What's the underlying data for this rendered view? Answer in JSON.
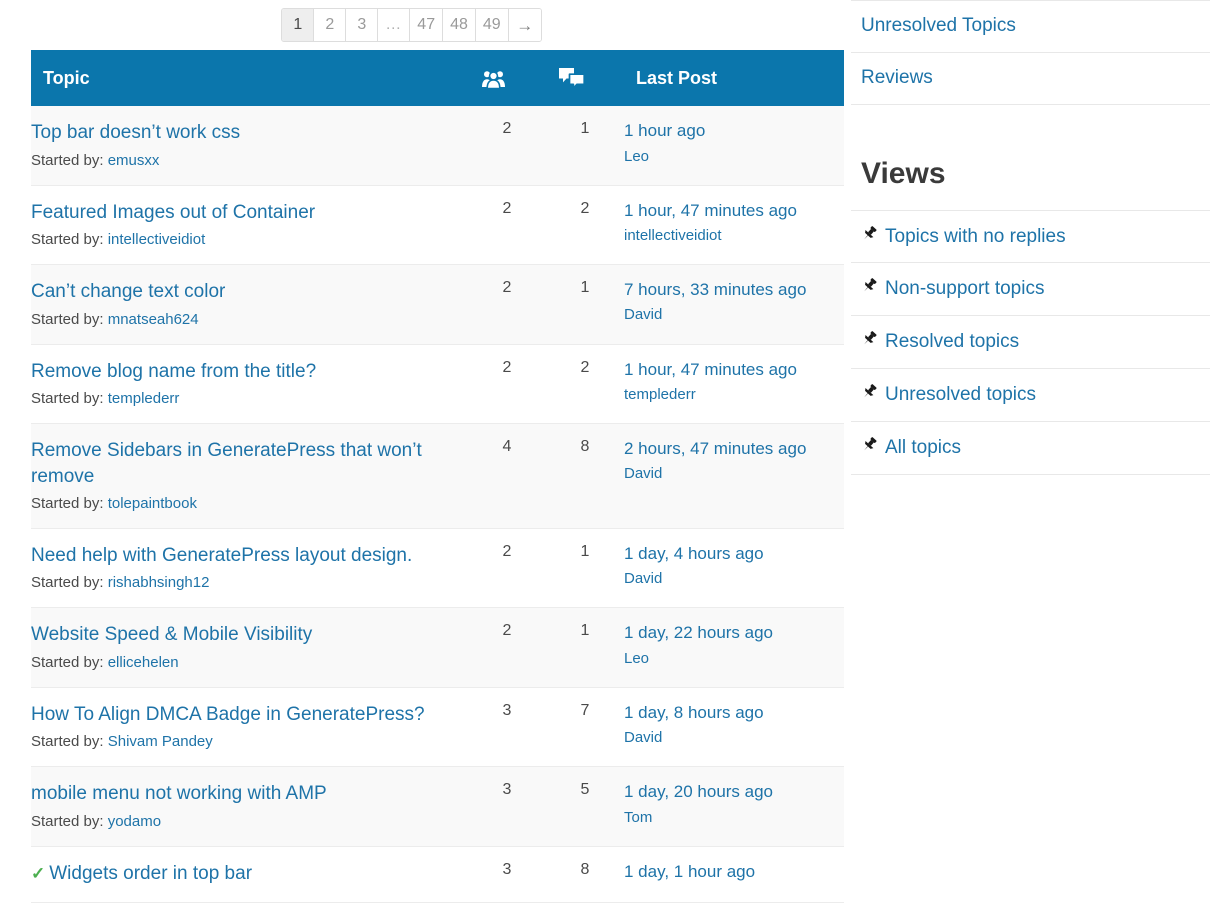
{
  "pagination": {
    "pages": [
      {
        "label": "1",
        "current": true,
        "kind": "page"
      },
      {
        "label": "2",
        "current": false,
        "kind": "page"
      },
      {
        "label": "3",
        "current": false,
        "kind": "page"
      },
      {
        "label": "…",
        "current": false,
        "kind": "dots"
      },
      {
        "label": "47",
        "current": false,
        "kind": "page"
      },
      {
        "label": "48",
        "current": false,
        "kind": "page"
      },
      {
        "label": "49",
        "current": false,
        "kind": "page"
      },
      {
        "label": "→",
        "current": false,
        "kind": "next"
      }
    ]
  },
  "table": {
    "header": {
      "topic": "Topic",
      "voices_icon": "users-icon",
      "posts_icon": "replies-icon",
      "last_post": "Last Post"
    },
    "started_by_label": "Started by:",
    "accent_color": "#0b76ac",
    "link_color": "#1e73a8",
    "alt_row_color": "#f9f9f9",
    "resolved_check_color": "#4caf50",
    "rows": [
      {
        "title": "Top bar doesn’t work css",
        "resolved": false,
        "author": "emusxx",
        "voices": "2",
        "posts": "1",
        "last_post_time": "1 hour ago",
        "last_post_author": "Leo"
      },
      {
        "title": "Featured Images out of Container",
        "resolved": false,
        "author": "intellectiveidiot",
        "voices": "2",
        "posts": "2",
        "last_post_time": "1 hour, 47 minutes ago",
        "last_post_author": "intellectiveidiot"
      },
      {
        "title": "Can’t change text color",
        "resolved": false,
        "author": "mnatseah624",
        "voices": "2",
        "posts": "1",
        "last_post_time": "7 hours, 33 minutes ago",
        "last_post_author": "David"
      },
      {
        "title": "Remove blog name from the title?",
        "resolved": false,
        "author": "templederr",
        "voices": "2",
        "posts": "2",
        "last_post_time": "1 hour, 47 minutes ago",
        "last_post_author": "templederr"
      },
      {
        "title": "Remove Sidebars in GeneratePress that won’t remove",
        "resolved": false,
        "author": "tolepaintbook",
        "voices": "4",
        "posts": "8",
        "last_post_time": "2 hours, 47 minutes ago",
        "last_post_author": "David"
      },
      {
        "title": "Need help with GeneratePress layout design.",
        "resolved": false,
        "author": "rishabhsingh12",
        "voices": "2",
        "posts": "1",
        "last_post_time": "1 day, 4 hours ago",
        "last_post_author": "David"
      },
      {
        "title": "Website Speed & Mobile Visibility",
        "resolved": false,
        "author": "ellicehelen",
        "voices": "2",
        "posts": "1",
        "last_post_time": "1 day, 22 hours ago",
        "last_post_author": "Leo"
      },
      {
        "title": "How To Align DMCA Badge in GeneratePress?",
        "resolved": false,
        "author": "Shivam Pandey",
        "voices": "3",
        "posts": "7",
        "last_post_time": "1 day, 8 hours ago",
        "last_post_author": "David"
      },
      {
        "title": "mobile menu not working with AMP",
        "resolved": false,
        "author": "yodamo",
        "voices": "3",
        "posts": "5",
        "last_post_time": "1 day, 20 hours ago",
        "last_post_author": "Tom"
      },
      {
        "title": "Widgets order in top bar",
        "resolved": true,
        "author": "",
        "voices": "3",
        "posts": "8",
        "last_post_time": "1 day, 1 hour ago",
        "last_post_author": ""
      }
    ]
  },
  "sidebar": {
    "top_links": [
      {
        "label": "Unresolved Topics"
      },
      {
        "label": "Reviews"
      }
    ],
    "views_heading": "Views",
    "views": [
      {
        "label": "Topics with no replies",
        "icon": "pushpin-icon"
      },
      {
        "label": "Non-support topics",
        "icon": "pushpin-icon"
      },
      {
        "label": "Resolved topics",
        "icon": "pushpin-icon"
      },
      {
        "label": "Unresolved topics",
        "icon": "pushpin-icon"
      },
      {
        "label": "All topics",
        "icon": "pushpin-icon"
      }
    ]
  }
}
